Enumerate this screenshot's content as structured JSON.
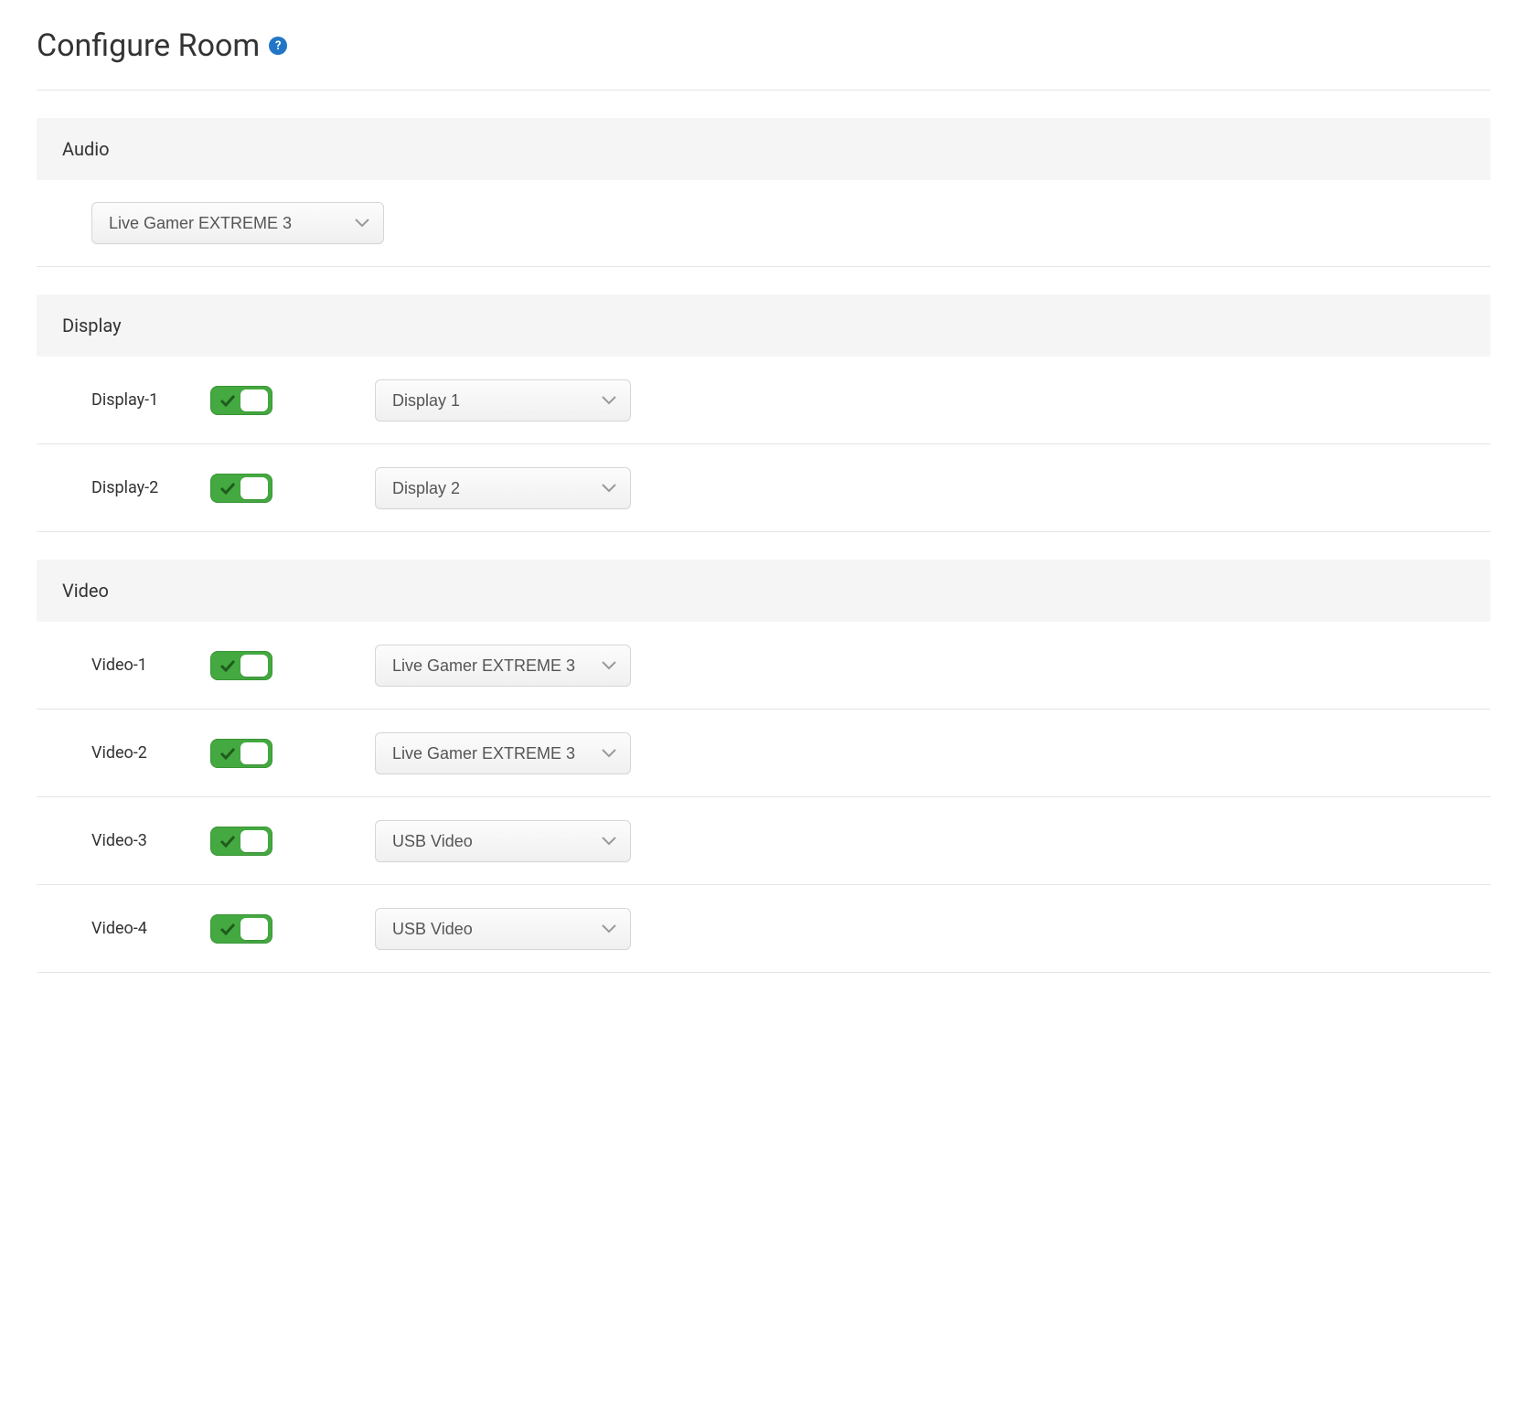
{
  "title": "Configure Room",
  "sections": {
    "audio": {
      "header": "Audio",
      "select_value": "Live Gamer EXTREME 3"
    },
    "display": {
      "header": "Display",
      "rows": [
        {
          "label": "Display-1",
          "enabled": true,
          "select_value": "Display 1"
        },
        {
          "label": "Display-2",
          "enabled": true,
          "select_value": "Display 2"
        }
      ]
    },
    "video": {
      "header": "Video",
      "rows": [
        {
          "label": "Video-1",
          "enabled": true,
          "select_value": "Live Gamer EXTREME 3"
        },
        {
          "label": "Video-2",
          "enabled": true,
          "select_value": "Live Gamer EXTREME 3"
        },
        {
          "label": "Video-3",
          "enabled": true,
          "select_value": "USB Video"
        },
        {
          "label": "Video-4",
          "enabled": true,
          "select_value": "USB Video"
        }
      ]
    }
  }
}
